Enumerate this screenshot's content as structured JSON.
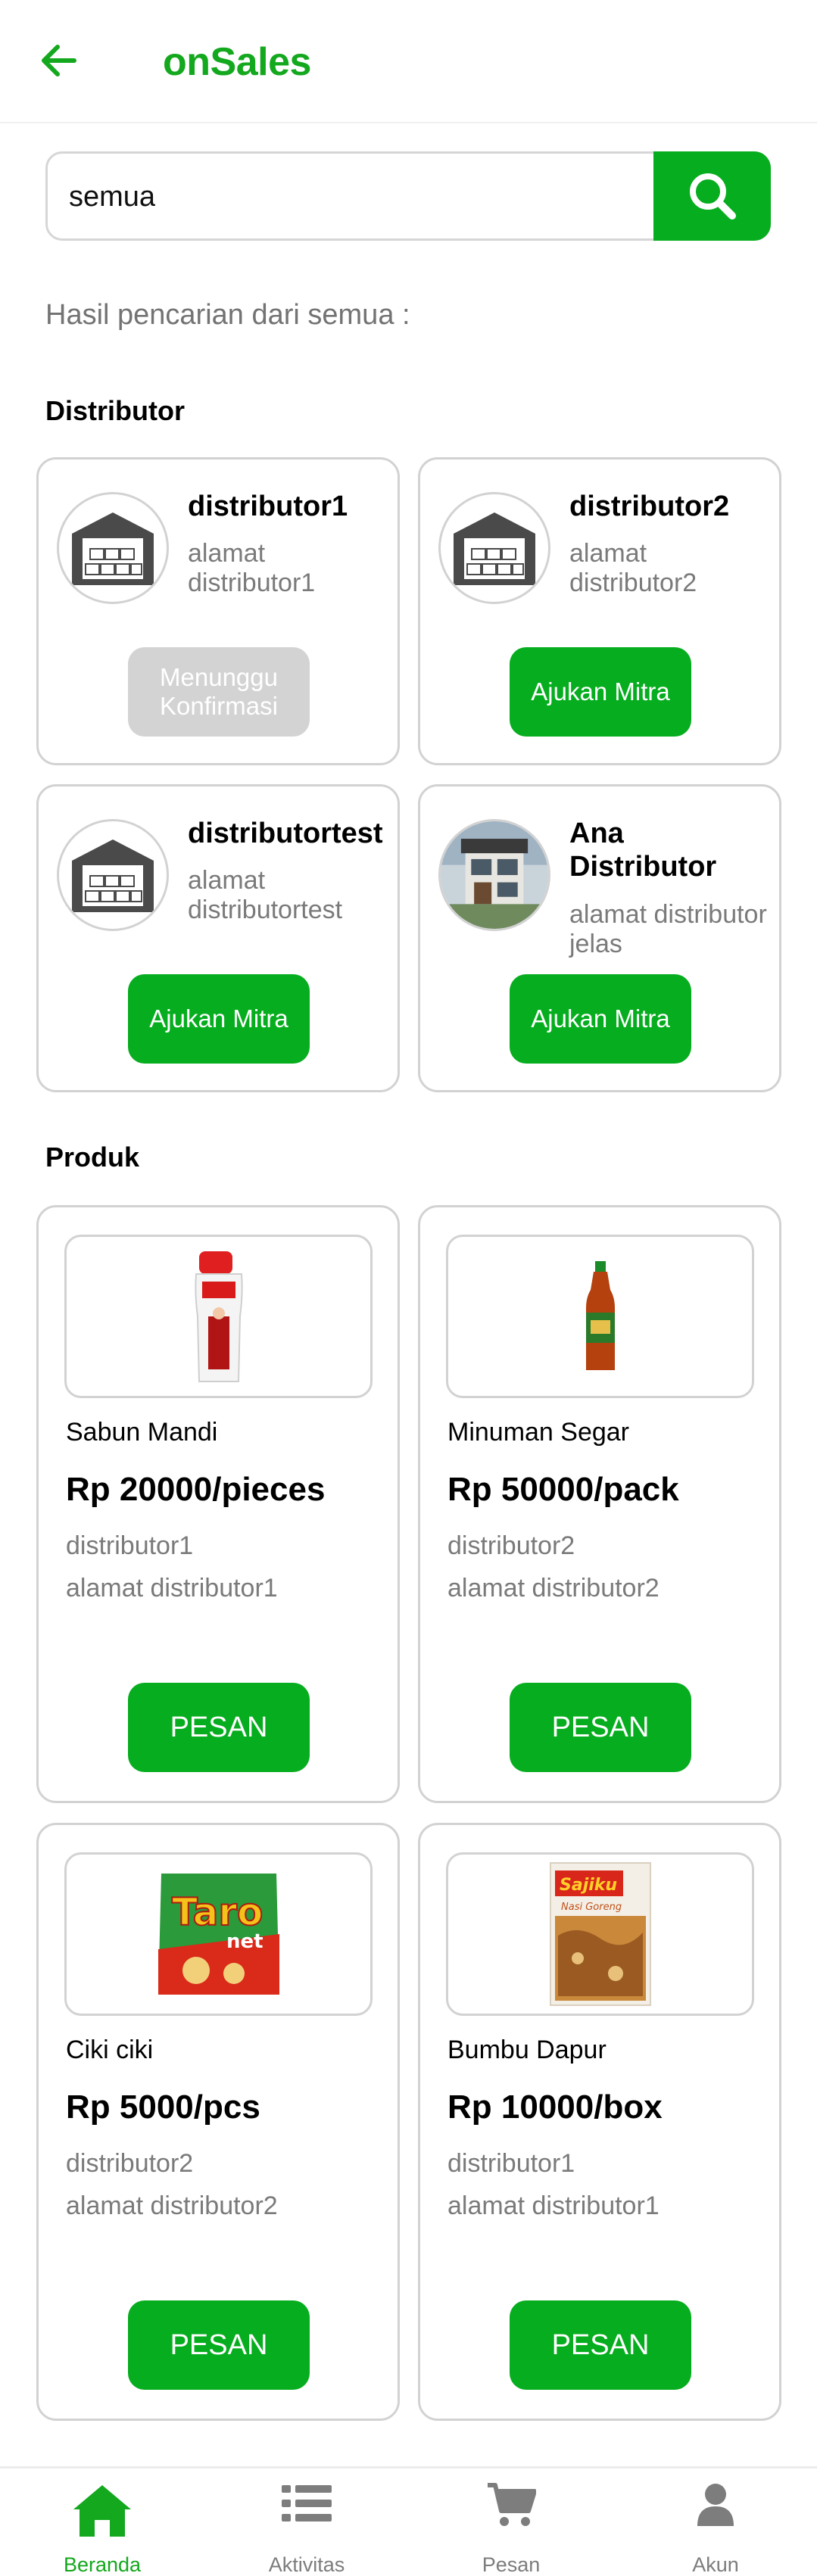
{
  "header": {
    "title": "onSales"
  },
  "search": {
    "value": "semua"
  },
  "results": {
    "title": "Hasil pencarian dari semua :"
  },
  "distributor_section": {
    "title": "Distributor"
  },
  "distributors": [
    {
      "name": "distributor1",
      "address": "alamat distributor1",
      "button": "Menunggu Konfirmasi",
      "status": "pending"
    },
    {
      "name": "distributor2",
      "address": "alamat distributor2",
      "button": "Ajukan Mitra",
      "status": "available"
    },
    {
      "name": "distributortest",
      "address": "alamat distributortest",
      "button": "Ajukan Mitra",
      "status": "available"
    },
    {
      "name": "Ana Distributor",
      "address": "alamat distributor jelas",
      "button": "Ajukan Mitra",
      "status": "available"
    }
  ],
  "product_section": {
    "title": "Produk"
  },
  "products": [
    {
      "name": "Sabun Mandi",
      "price": "Rp 20000/pieces",
      "distributor": "distributor1",
      "address": "alamat distributor1",
      "button": "PESAN",
      "image": "soap-bottle-icon"
    },
    {
      "name": "Minuman Segar",
      "price": "Rp 50000/pack",
      "distributor": "distributor2",
      "address": "alamat distributor2",
      "button": "PESAN",
      "image": "drink-bottle-icon"
    },
    {
      "name": "Ciki ciki",
      "price": "Rp 5000/pcs",
      "distributor": "distributor2",
      "address": "alamat distributor2",
      "button": "PESAN",
      "image": "snack-pack-icon"
    },
    {
      "name": "Bumbu Dapur",
      "price": "Rp 10000/box",
      "distributor": "distributor1",
      "address": "alamat distributor1",
      "button": "PESAN",
      "image": "seasoning-pack-icon"
    }
  ],
  "nav": [
    {
      "label": "Beranda",
      "icon": "home-icon",
      "active": true
    },
    {
      "label": "Aktivitas",
      "icon": "list-icon",
      "active": false
    },
    {
      "label": "Pesan",
      "icon": "cart-icon",
      "active": false
    },
    {
      "label": "Akun",
      "icon": "user-icon",
      "active": false
    }
  ],
  "colors": {
    "brand": "#06ad1e",
    "pending": "#d3d3d3",
    "muted": "#7a7a7a"
  }
}
